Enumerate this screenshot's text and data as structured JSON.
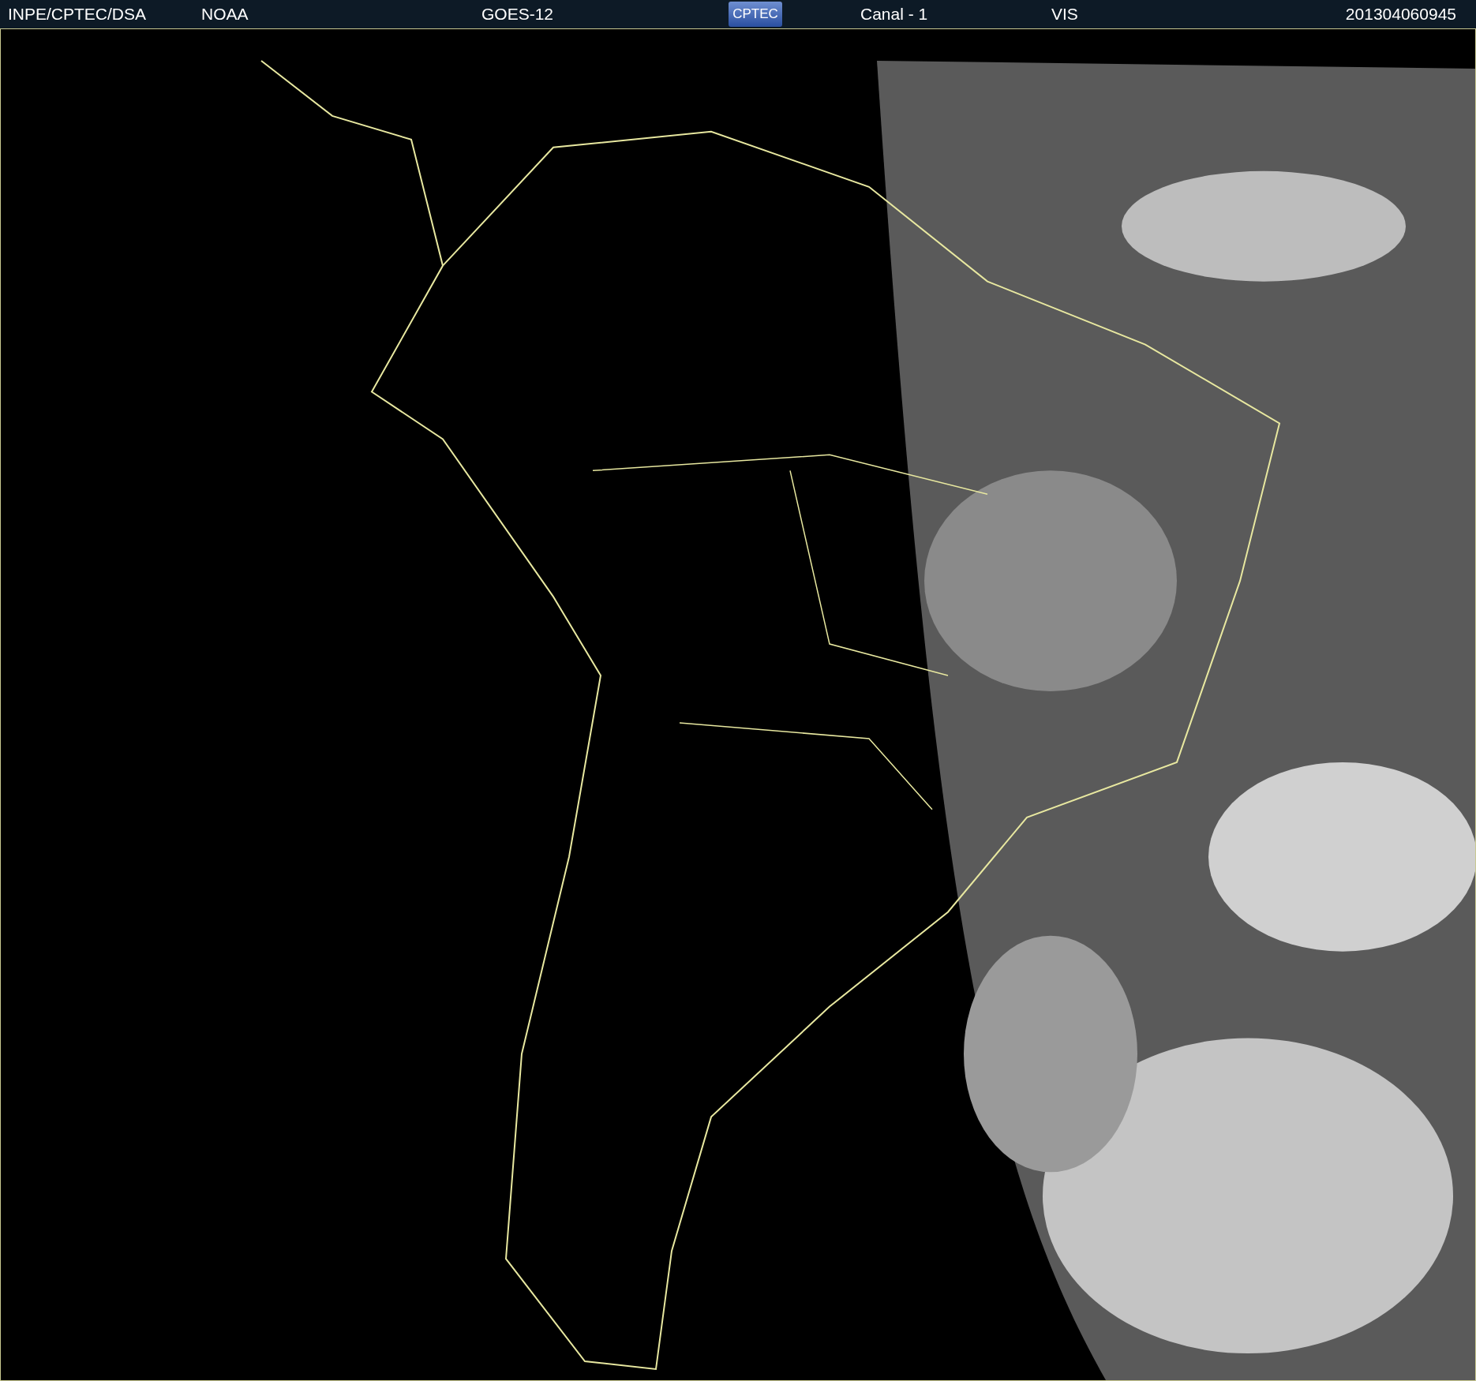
{
  "header": {
    "items": [
      {
        "kind": "text",
        "text": "INPE/CPTEC/DSA"
      },
      {
        "kind": "text",
        "text": "NOAA"
      },
      {
        "kind": "text",
        "text": "GOES-12"
      },
      {
        "kind": "logo",
        "text": "CPTEC"
      },
      {
        "kind": "text",
        "text": "Canal - 1"
      },
      {
        "kind": "text",
        "text": "VIS"
      },
      {
        "kind": "text",
        "text": "201304060945"
      }
    ]
  }
}
